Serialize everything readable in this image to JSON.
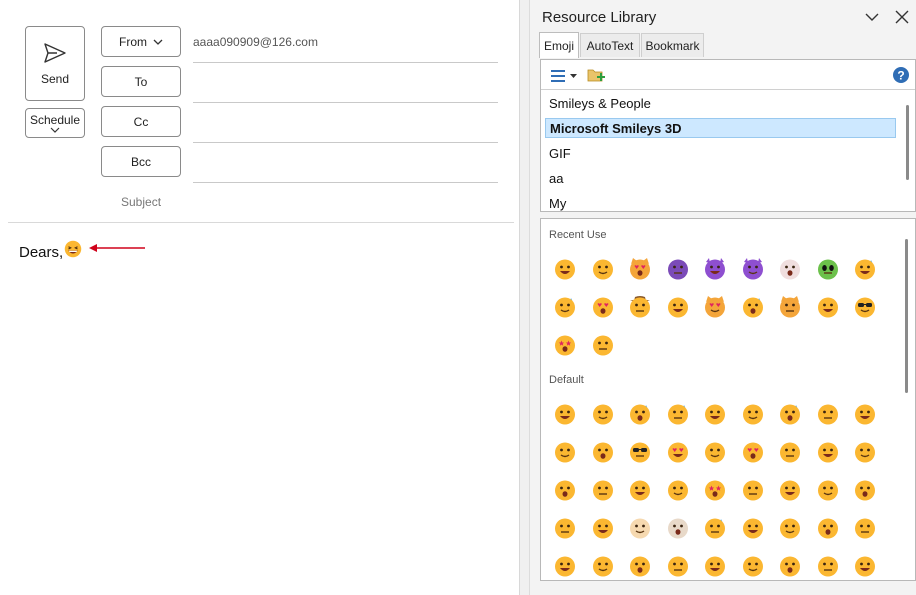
{
  "compose": {
    "send_label": "Send",
    "schedule_label": "Schedule",
    "from_label": "From",
    "from_value": "aaaa090909@126.com",
    "to_label": "To",
    "cc_label": "Cc",
    "bcc_label": "Bcc",
    "subject_label": "Subject",
    "body_text": "Dears,"
  },
  "panel": {
    "title": "Resource Library",
    "tabs": [
      "Emoji",
      "AutoText",
      "Bookmark"
    ],
    "active_tab": "Emoji",
    "categories": [
      "Smileys & People",
      "Microsoft Smileys 3D",
      "GIF",
      "aa",
      "My"
    ],
    "selected_category": "Microsoft Smileys 3D",
    "sections": [
      "Recent Use",
      "Default"
    ],
    "help_glyph": "?"
  },
  "colors": {
    "accent": "#2f6db5",
    "selection_bg": "#cde8ff",
    "arrow": "#d0021b",
    "emoji_yellow": "#fbb731"
  },
  "recent_emojis": [
    "grinning-squint-face",
    "face-holding-back-tears",
    "smiling-cat-heart-eyes",
    "alien-monster",
    "smiling-imp",
    "angry-imp",
    "clown-face",
    "alien",
    "laughing-sweat",
    "rolling-laughing",
    "smiling-hearts",
    "cowboy-face",
    "face-blowing-kiss",
    "heart-eyes-cat",
    "grin-sweat",
    "pouting-cat",
    "screaming-fear",
    "sunglasses-face",
    "star-struck",
    "astonished-face"
  ],
  "default_emojis": [
    "grinning-face",
    "beaming-face",
    "grin-sweat",
    "rolling-laughing",
    "grinning-big-eyes",
    "grinning-smiling-eyes",
    "grin-sweat-2",
    "squinting-laughing",
    "winking-tongue",
    "smiling-face",
    "face-savoring",
    "sunglasses-face",
    "heart-eyes",
    "face-blowing-kiss",
    "smiling-hearts",
    "kissing-face",
    "kissing-smiling",
    "face-hugging-eyes",
    "kissing-closed-eyes",
    "relieved-face",
    "slightly-smiling",
    "hugging-face",
    "star-struck",
    "thinking-face",
    "saluting-face",
    "face-with-hand",
    "neutral-face",
    "expressionless",
    "no-mouth",
    "dotted-line-face",
    "shaking-face",
    "rolling-eyes",
    "smirking-face",
    "persevering-face",
    "sad-relieved",
    "hushed-face",
    "zipper-mouth",
    "astonished-face",
    "woozy-face",
    "tired-face",
    "yawning-face",
    "sleeping-face",
    "relieved-2",
    "tongue-out",
    "drooling-face"
  ]
}
